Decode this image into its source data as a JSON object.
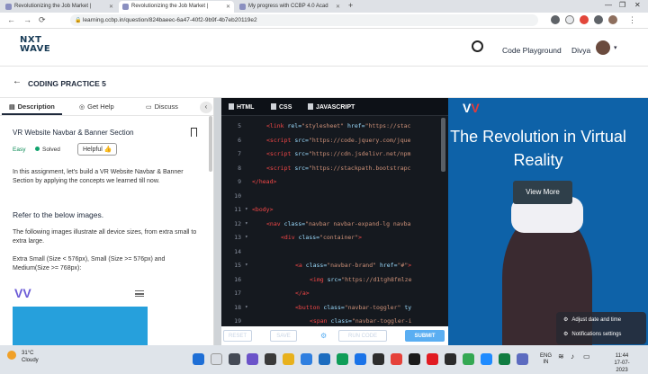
{
  "browser": {
    "tabs": [
      {
        "title": "Revolutionizing the Job Market |",
        "active": false
      },
      {
        "title": "Revolutionizing the Job Market |",
        "active": true
      },
      {
        "title": "My progress with CCBP 4.0 Acad",
        "active": false
      }
    ],
    "new_tab_label": "+",
    "url": "learning.ccbp.in/question/824baeec-6a47-40f2-9b9f-4b7eb20119e2"
  },
  "site": {
    "logo_line1": "NXT",
    "logo_line2": "WAVE",
    "code_playground": "Code Playground",
    "user_name": "Divya"
  },
  "page": {
    "title": "CODING PRACTICE 5"
  },
  "left_panel": {
    "tabs": [
      {
        "label": "Description",
        "icon": "description-icon"
      },
      {
        "label": "Get Help",
        "icon": "help-icon"
      },
      {
        "label": "Discuss",
        "icon": "discuss-icon"
      }
    ],
    "question_title": "VR Website Navbar & Banner Section",
    "difficulty": "Easy",
    "status": "Solved",
    "helpful_label": "Helpful",
    "intro": "In this assignment, let's build a VR Website Navbar & Banner Section by applying the concepts we learned till now.",
    "refer_heading": "Refer to the below images.",
    "devices_text": "The following images illustrate all device sizes, from extra small to extra large.",
    "sizes_text": "Extra Small (Size < 576px), Small (Size >= 576px) and Medium(Size >= 768px):"
  },
  "editor": {
    "tabs": [
      "HTML",
      "CSS",
      "JAVASCRIPT"
    ],
    "lines": [
      {
        "num": "5",
        "fold": false,
        "indent": 2,
        "parts": [
          [
            "tg",
            "<link "
          ],
          [
            "at",
            "rel="
          ],
          [
            "sv",
            "\"stylesheet\" "
          ],
          [
            "at",
            "href="
          ],
          [
            "sv",
            "\"https://stac"
          ]
        ]
      },
      {
        "num": "6",
        "fold": false,
        "indent": 2,
        "parts": [
          [
            "tg",
            "<script "
          ],
          [
            "at",
            "src="
          ],
          [
            "sv",
            "\"https://code.jquery.com/jque"
          ]
        ]
      },
      {
        "num": "7",
        "fold": false,
        "indent": 2,
        "parts": [
          [
            "tg",
            "<script "
          ],
          [
            "at",
            "src="
          ],
          [
            "sv",
            "\"https://cdn.jsdelivr.net/npm"
          ]
        ]
      },
      {
        "num": "8",
        "fold": false,
        "indent": 2,
        "parts": [
          [
            "tg",
            "<script "
          ],
          [
            "at",
            "src="
          ],
          [
            "sv",
            "\"https://stackpath.bootstrapc"
          ]
        ]
      },
      {
        "num": "9",
        "fold": false,
        "indent": 0,
        "parts": [
          [
            "tg",
            "</head>"
          ]
        ]
      },
      {
        "num": "10",
        "fold": false,
        "indent": 0,
        "parts": []
      },
      {
        "num": "11",
        "fold": true,
        "indent": 0,
        "parts": [
          [
            "tg",
            "<body>"
          ]
        ]
      },
      {
        "num": "12",
        "fold": true,
        "indent": 2,
        "parts": [
          [
            "tg",
            "<nav "
          ],
          [
            "at",
            "class="
          ],
          [
            "sv",
            "\"navbar navbar-expand-lg navba"
          ]
        ]
      },
      {
        "num": "13",
        "fold": true,
        "indent": 4,
        "parts": [
          [
            "tg",
            "<div "
          ],
          [
            "at",
            "class="
          ],
          [
            "sv",
            "\"container\""
          ],
          [
            "tg",
            ">"
          ]
        ]
      },
      {
        "num": "14",
        "fold": false,
        "indent": 0,
        "parts": []
      },
      {
        "num": "15",
        "fold": true,
        "indent": 6,
        "parts": [
          [
            "tg",
            "<a "
          ],
          [
            "at",
            "class="
          ],
          [
            "sv",
            "\"navbar-brand\" "
          ],
          [
            "at",
            "href="
          ],
          [
            "sv",
            "\"#\""
          ],
          [
            "tg",
            ">"
          ]
        ]
      },
      {
        "num": "16",
        "fold": false,
        "indent": 8,
        "parts": [
          [
            "tg",
            "<img "
          ],
          [
            "at",
            "src="
          ],
          [
            "sv",
            "\"https://d1tgh8fmlze"
          ]
        ]
      },
      {
        "num": "17",
        "fold": false,
        "indent": 6,
        "parts": [
          [
            "tg",
            "</a>"
          ]
        ]
      },
      {
        "num": "18",
        "fold": true,
        "indent": 6,
        "parts": [
          [
            "tg",
            "<button "
          ],
          [
            "at",
            "class="
          ],
          [
            "sv",
            "\"navbar-toggler\" "
          ],
          [
            "at",
            "ty"
          ]
        ]
      },
      {
        "num": "19",
        "fold": false,
        "indent": 8,
        "parts": [
          [
            "tg",
            "<span "
          ],
          [
            "at",
            "class="
          ],
          [
            "sv",
            "\"navbar-toggler-i"
          ]
        ]
      }
    ],
    "footer": {
      "reset": "RESET",
      "save": "SAVE",
      "run": "RUN CODE",
      "submit": "SUBMIT"
    }
  },
  "preview": {
    "heading": "The Revolution in Virtual Reality",
    "button": "View More"
  },
  "notifications": {
    "item1": "Adjust date and time",
    "item2": "Notifications settings"
  },
  "taskbar": {
    "temp": "31°C",
    "weather": "Cloudy",
    "lang1": "ENG",
    "lang2": "IN",
    "time": "11:44",
    "date": "17-07-2023"
  }
}
